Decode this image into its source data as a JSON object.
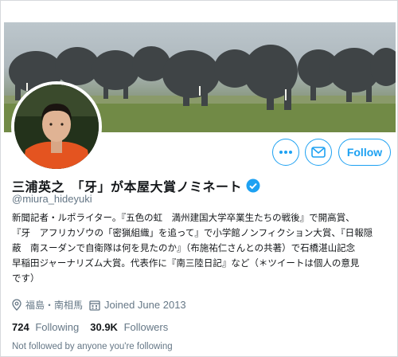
{
  "profile": {
    "display_name": "三浦英之　「牙」が本屋大賞ノミネート",
    "handle": "@miura_hideyuki",
    "verified": true,
    "bio_lines": [
      "新聞記者・ルポライター。『五色の虹　満州建国大学卒業生たちの戦後』で開高賞、",
      "『牙　アフリカゾウの「密猟組織」を追って』で小学館ノンフィクション大賞、『日報隠",
      "蔽　南スーダンで自衛隊は何を見たのか』（布施祐仁さんとの共著）で石橋湛山記念",
      "早稲田ジャーナリズム大賞。代表作に『南三陸日記』など（＊ツイートは個人の意見",
      "です）"
    ],
    "location": "福島・南相馬",
    "joined": "Joined June 2013",
    "following_count": "724",
    "following_label": "Following",
    "followers_count": "30.9K",
    "followers_label": "Followers",
    "not_followed_text": "Not followed by anyone you're following"
  },
  "actions": {
    "follow_label": "Follow",
    "more_icon": "more-dots-icon",
    "message_icon": "envelope-icon"
  },
  "colors": {
    "accent": "#1da1f2",
    "secondary_text": "#657786",
    "primary_text": "#14171a"
  }
}
